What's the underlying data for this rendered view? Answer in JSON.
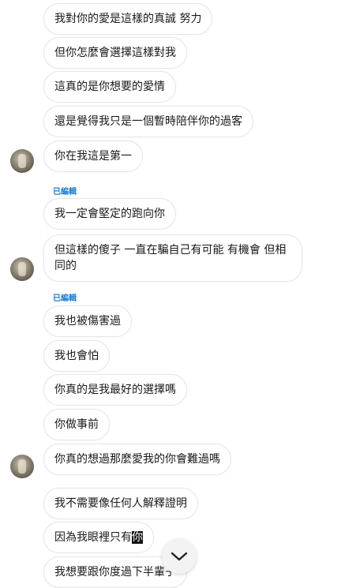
{
  "messages": [
    {
      "text": "我對你的愛是這樣的真誠 努力"
    },
    {
      "text": "但你怎麼會選擇這樣對我"
    },
    {
      "text": "這真的是你想要的愛情"
    },
    {
      "text": "還是覺得我只是一個暫時陪伴你的過客"
    },
    {
      "text": "你在我這是第一"
    },
    {
      "text": "我一定會堅定的跑向你"
    },
    {
      "text": "但這樣的傻子 一直在騙自己有可能 有機會 但相同的"
    },
    {
      "text": "我也被傷害過"
    },
    {
      "text": "我也會怕"
    },
    {
      "text": "你真的是我最好的選擇嗎"
    },
    {
      "text": "你做事前"
    },
    {
      "text": "你真的想過那麼愛我的你會難過嗎"
    },
    {
      "text": "我不需要像任何人解釋證明"
    },
    {
      "text_before": "因為我眼裡只有",
      "text_highlight": "你"
    },
    {
      "text": "我想要跟你度過下半輩子"
    }
  ],
  "edited_labels": [
    "已編輯",
    "已編輯"
  ],
  "icons": {
    "avatar": "user-avatar",
    "scroll_down": "chevron-down-icon"
  }
}
